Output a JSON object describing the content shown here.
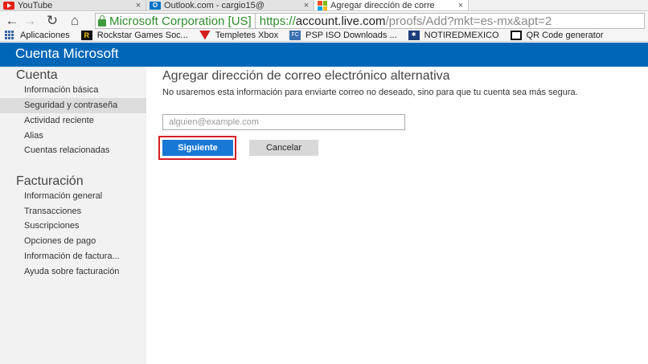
{
  "browser": {
    "tabs": [
      {
        "label": "YouTube",
        "icon": "youtube-icon",
        "close": "×"
      },
      {
        "label": "Outlook.com - cargio15@",
        "icon": "outlook-icon",
        "close": "×"
      },
      {
        "label": "Agregar dirección de corre",
        "icon": "microsoft-icon",
        "close": "×"
      }
    ],
    "active_tab": 2,
    "nav": {
      "back": "←",
      "forward": "→",
      "reload": "↻",
      "home": "⌂"
    },
    "ev_label": "Microsoft Corporation [US]",
    "url_scheme": "https://",
    "url_host": "account.live.com",
    "url_path": "/proofs/Add?mkt=es-mx&apt=2",
    "bookmarks": [
      {
        "label": "Aplicaciones",
        "icon": "apps-grid-icon"
      },
      {
        "label": "Rockstar Games Soc...",
        "icon": "rockstar-icon"
      },
      {
        "label": "Templetes Xbox",
        "icon": "templetes-icon"
      },
      {
        "label": "PSP ISO Downloads ...",
        "icon": "psp-icon"
      },
      {
        "label": "NOTIREDMEXICO",
        "icon": "notiredmexico-icon"
      },
      {
        "label": "QR Code generator",
        "icon": "qr-icon"
      }
    ]
  },
  "header": {
    "title": "Cuenta Microsoft",
    "color": "#0067b8"
  },
  "sidebar": {
    "sections": [
      {
        "heading": "Cuenta",
        "items": [
          "Información básica",
          "Seguridad y contraseña",
          "Actividad reciente",
          "Alias",
          "Cuentas relacionadas"
        ]
      },
      {
        "heading": "Facturación",
        "items": [
          "Información general",
          "Transacciones",
          "Suscripciones",
          "Opciones de pago",
          "Información de factura...",
          "Ayuda sobre facturación"
        ]
      }
    ],
    "active_item": "Seguridad y contraseña"
  },
  "main": {
    "title": "Agregar dirección de correo electrónico alternativa",
    "description": "No usaremos esta información para enviarte correo no deseado, sino para que tu cuenta sea más segura.",
    "email_placeholder": "alguien@example.com",
    "email_value": "",
    "next_label": "Siguiente",
    "cancel_label": "Cancelar",
    "accent_color": "#1878d6",
    "highlight_color": "#d71f26"
  }
}
